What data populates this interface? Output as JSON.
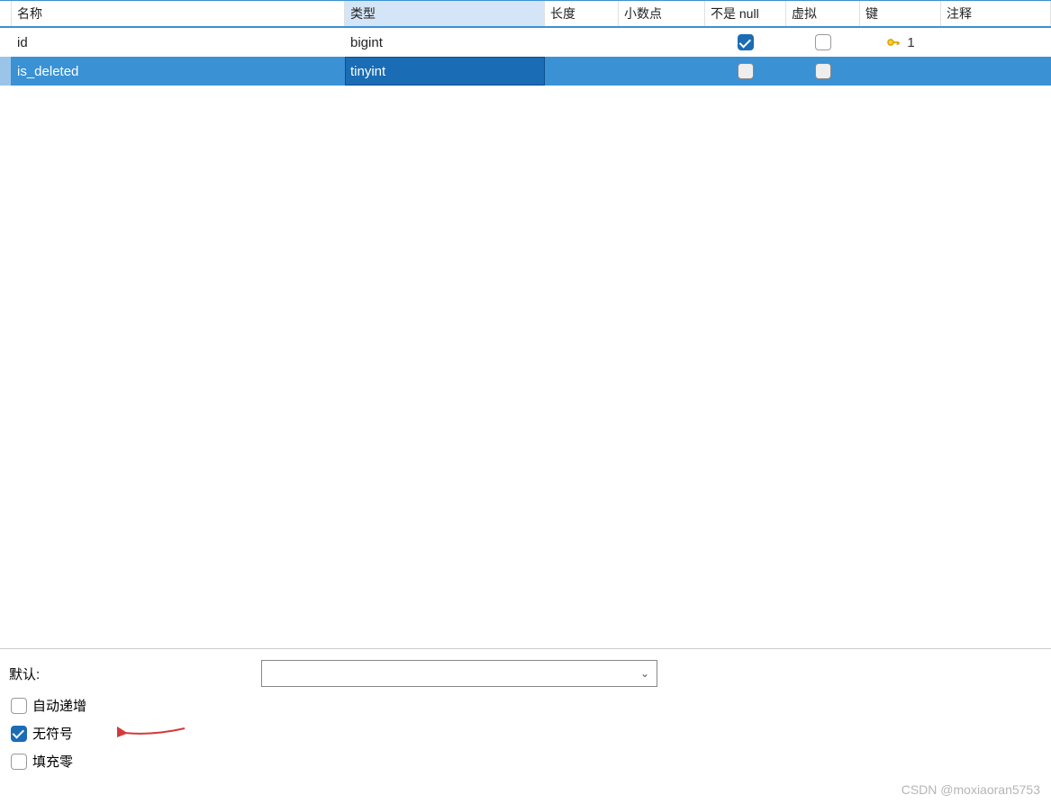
{
  "table": {
    "headers": {
      "name": "名称",
      "type": "类型",
      "length": "长度",
      "decimal": "小数点",
      "notnull": "不是 null",
      "virtual": "虚拟",
      "key": "键",
      "comment": "注释"
    },
    "rows": [
      {
        "name": "id",
        "type": "bigint",
        "length": "",
        "decimal": "",
        "notnull": true,
        "virtual": false,
        "key": "1",
        "comment": "",
        "selected": false
      },
      {
        "name": "is_deleted",
        "type": "tinyint",
        "length": "",
        "decimal": "",
        "notnull": false,
        "virtual": false,
        "key": "",
        "comment": "",
        "selected": true
      }
    ]
  },
  "panel": {
    "default_label": "默认:",
    "default_value": "",
    "auto_increment": "自动递增",
    "unsigned": "无符号",
    "zerofill": "填充零",
    "auto_increment_checked": false,
    "unsigned_checked": true,
    "zerofill_checked": false
  },
  "watermark": "CSDN @moxiaoran5753"
}
